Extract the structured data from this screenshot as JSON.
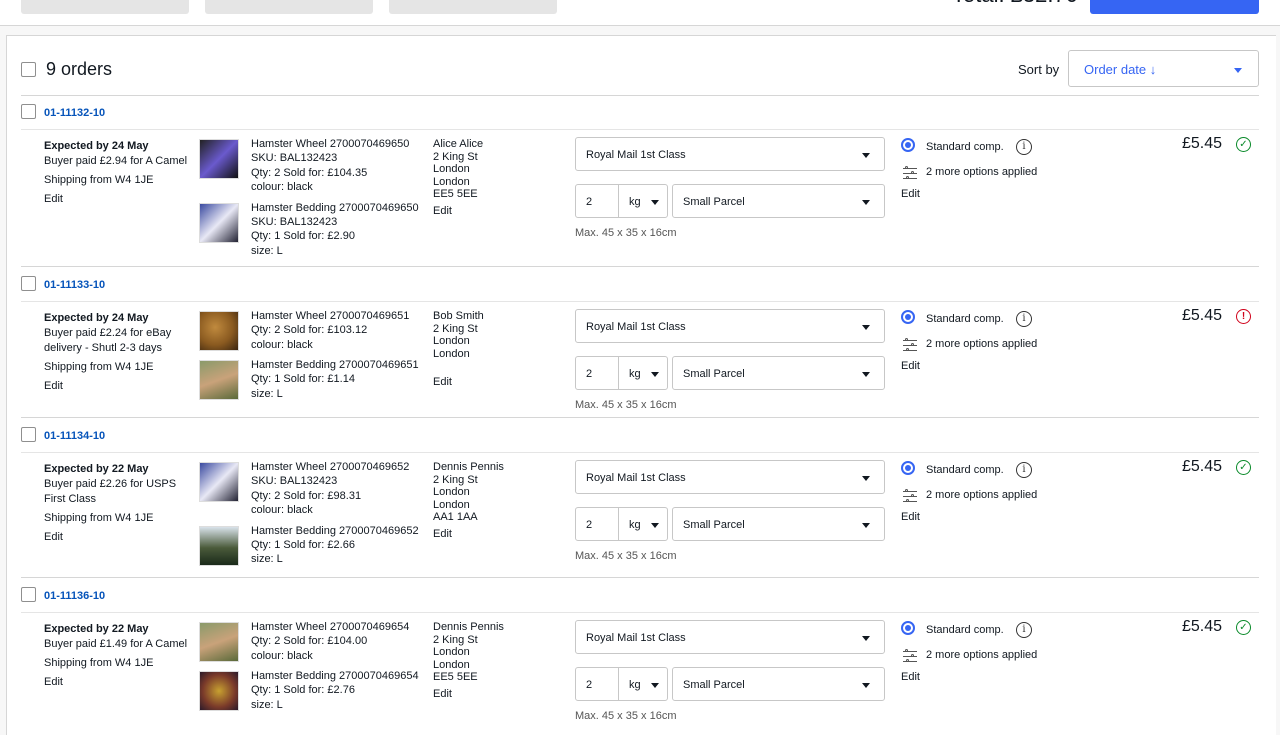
{
  "top": {
    "total_label": "Total: £32.70"
  },
  "header": {
    "orders_count": "9 orders",
    "sort_label": "Sort by",
    "sort_value": "Order date ↓"
  },
  "orders": [
    {
      "id": "01-11132-10",
      "expected": "Expected by 24 May",
      "buyer_paid_lines": [
        "Buyer paid £2.94 for A Camel"
      ],
      "shipping_from": "Shipping from W4 1JE",
      "edit": "Edit",
      "items": [
        {
          "title": "Hamster Wheel 2700070469650",
          "lines": [
            "SKU: BAL132423",
            "Qty: 2   Sold for: £104.35",
            "colour: black"
          ]
        },
        {
          "title": "Hamster Bedding 2700070469650",
          "lines": [
            "SKU: BAL132423",
            "Qty: 1   Sold for: £2.90",
            "size: L"
          ]
        }
      ],
      "address": [
        "Alice Alice",
        "2 King St",
        "London",
        "London",
        "EE5 5EE"
      ],
      "address_edit": "Edit",
      "service": "Royal Mail 1st Class",
      "weight": "2",
      "unit": "kg",
      "package": "Small Parcel",
      "max": "Max. 45 x 35 x 16cm",
      "option": "Standard comp.",
      "more_options": "2 more options applied",
      "options_edit": "Edit",
      "price": "£5.45",
      "status": "ok"
    },
    {
      "id": "01-11133-10",
      "expected": "Expected by 24 May",
      "buyer_paid_lines": [
        "Buyer paid £2.24 for eBay",
        "delivery - Shutl 2-3 days"
      ],
      "shipping_from": "Shipping from W4 1JE",
      "edit": "Edit",
      "items": [
        {
          "title": "Hamster Wheel 2700070469651",
          "lines": [
            "Qty: 2   Sold for: £103.12",
            "colour: black"
          ]
        },
        {
          "title": "Hamster Bedding 2700070469651",
          "lines": [
            "Qty: 1   Sold for: £1.14",
            "size: L"
          ]
        }
      ],
      "address": [
        "Bob Smith",
        "2 King St",
        "London",
        "London"
      ],
      "address_edit": "Edit",
      "service": "Royal Mail 1st Class",
      "weight": "2",
      "unit": "kg",
      "package": "Small Parcel",
      "max": "Max. 45 x 35 x 16cm",
      "option": "Standard comp.",
      "more_options": "2 more options applied",
      "options_edit": "Edit",
      "price": "£5.45",
      "status": "error"
    },
    {
      "id": "01-11134-10",
      "expected": "Expected by 22 May",
      "buyer_paid_lines": [
        "Buyer paid £2.26 for USPS",
        "First Class"
      ],
      "shipping_from": "Shipping from W4 1JE",
      "edit": "Edit",
      "items": [
        {
          "title": "Hamster Wheel 2700070469652",
          "lines": [
            "SKU: BAL132423",
            "Qty: 2   Sold for: £98.31",
            "colour: black"
          ]
        },
        {
          "title": "Hamster Bedding 2700070469652",
          "lines": [
            "Qty: 1   Sold for: £2.66",
            "size: L"
          ]
        }
      ],
      "address": [
        "Dennis Pennis",
        "2 King St",
        "London",
        "London",
        "AA1 1AA"
      ],
      "address_edit": "Edit",
      "service": "Royal Mail 1st Class",
      "weight": "2",
      "unit": "kg",
      "package": "Small Parcel",
      "max": "Max. 45 x 35 x 16cm",
      "option": "Standard comp.",
      "more_options": "2 more options applied",
      "options_edit": "Edit",
      "price": "£5.45",
      "status": "ok"
    },
    {
      "id": "01-11136-10",
      "expected": "Expected by 22 May",
      "buyer_paid_lines": [
        "Buyer paid £1.49 for A Camel"
      ],
      "shipping_from": "Shipping from W4 1JE",
      "edit": "Edit",
      "items": [
        {
          "title": "Hamster Wheel 2700070469654",
          "lines": [
            "Qty: 2   Sold for: £104.00",
            "colour: black"
          ]
        },
        {
          "title": "Hamster Bedding 2700070469654",
          "lines": [
            "Qty: 1   Sold for: £2.76",
            "size: L"
          ]
        }
      ],
      "address": [
        "Dennis Pennis",
        "2 King St",
        "London",
        "London",
        "EE5 5EE"
      ],
      "address_edit": "Edit",
      "service": "Royal Mail 1st Class",
      "weight": "2",
      "unit": "kg",
      "package": "Small Parcel",
      "max": "Max. 45 x 35 x 16cm",
      "option": "Standard comp.",
      "more_options": "2 more options applied",
      "options_edit": "Edit",
      "price": "£5.45",
      "status": "ok"
    }
  ]
}
